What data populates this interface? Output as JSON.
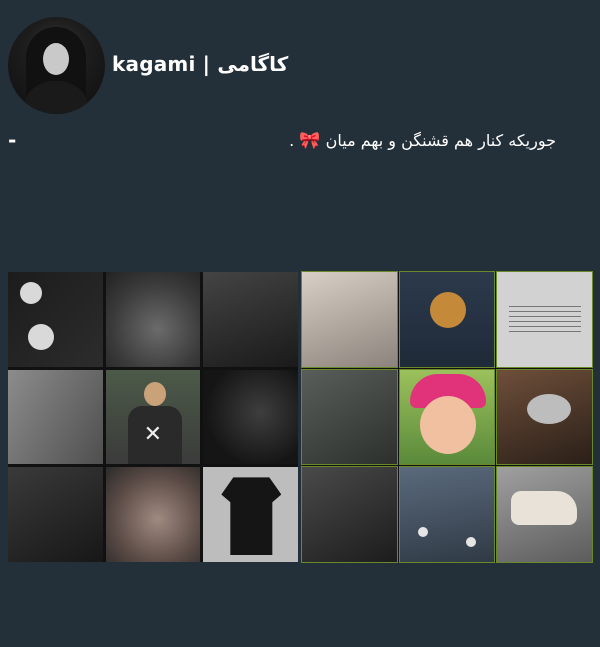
{
  "profile": {
    "username": "kagami | کاگامی",
    "bio_text": "جوریکه کنار هم قشنگن و بهم میان",
    "bio_emoji": "🎀",
    "bio_suffix": ".",
    "separator": "-"
  },
  "collages": {
    "left_label": "collage-left",
    "right_label": "collage-right"
  }
}
